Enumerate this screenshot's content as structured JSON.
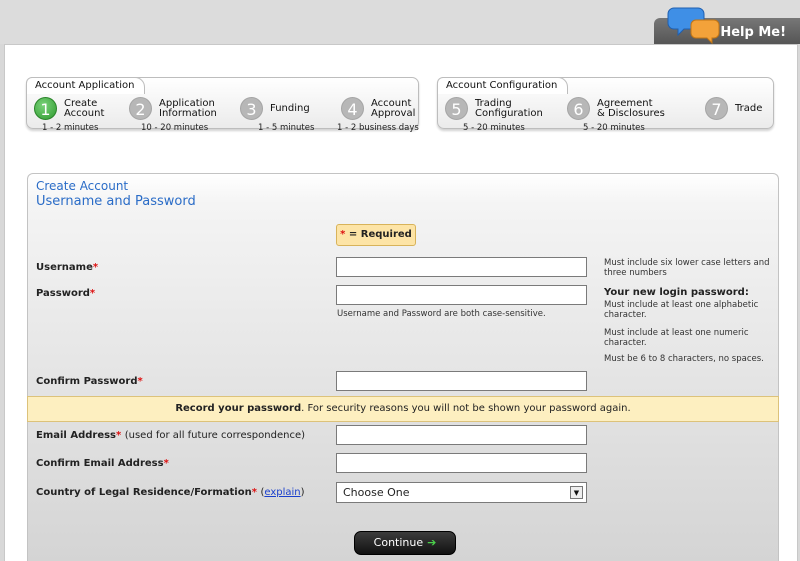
{
  "help": {
    "label": "Help Me!"
  },
  "application_steps": {
    "group_label": "Account Application",
    "steps": [
      {
        "number": "1",
        "label_line1": "Create",
        "label_line2": "Account",
        "time": "1 - 2 minutes",
        "active": true
      },
      {
        "number": "2",
        "label_line1": "Application",
        "label_line2": "Information",
        "time": "10 - 20 minutes"
      },
      {
        "number": "3",
        "label_line1": "Funding",
        "label_line2": "",
        "time": "1 - 5 minutes"
      },
      {
        "number": "4",
        "label_line1": "Account",
        "label_line2": "Approval",
        "time": "1 - 2 business days"
      }
    ]
  },
  "configuration_steps": {
    "group_label": "Account Configuration",
    "steps": [
      {
        "number": "5",
        "label_line1": "Trading",
        "label_line2": "Configuration",
        "time": "5 - 20 minutes"
      },
      {
        "number": "6",
        "label_line1": "Agreement",
        "label_line2": "& Disclosures",
        "time": "5 - 20 minutes"
      },
      {
        "number": "7",
        "label_line1": "Trade",
        "label_line2": "",
        "time": ""
      }
    ]
  },
  "form": {
    "title": "Create Account",
    "subtitle": "Username and Password",
    "required_star": "*",
    "required_text": "= Required",
    "username_label": "Username",
    "password_label": "Password",
    "confirm_password_label": "Confirm Password",
    "case_note": "Username and Password are both case-sensitive.",
    "username_hint": "Must include six lower case letters and three numbers",
    "password_hint_title": "Your new login password:",
    "password_hint_1": "Must include at least one alphabetic character.",
    "password_hint_2": "Must include at least one numeric character.",
    "password_hint_3": "Must be 6 to 8 characters, no spaces.",
    "record_bold": "Record your password",
    "record_rest": ". For security reasons you will not be shown your password again.",
    "email_label": "Email Address",
    "email_note": "(used for all future correspondence)",
    "confirm_email_label": "Confirm Email Address",
    "country_label": "Country of Legal Residence/Formation",
    "explain_open": "(",
    "explain_link": "explain",
    "explain_close": ")",
    "country_value": "Choose One",
    "continue_label": "Continue"
  },
  "colors": {
    "accent": "#2a6cc7",
    "required": "#d11111",
    "active_step": "#2e9a2e"
  }
}
